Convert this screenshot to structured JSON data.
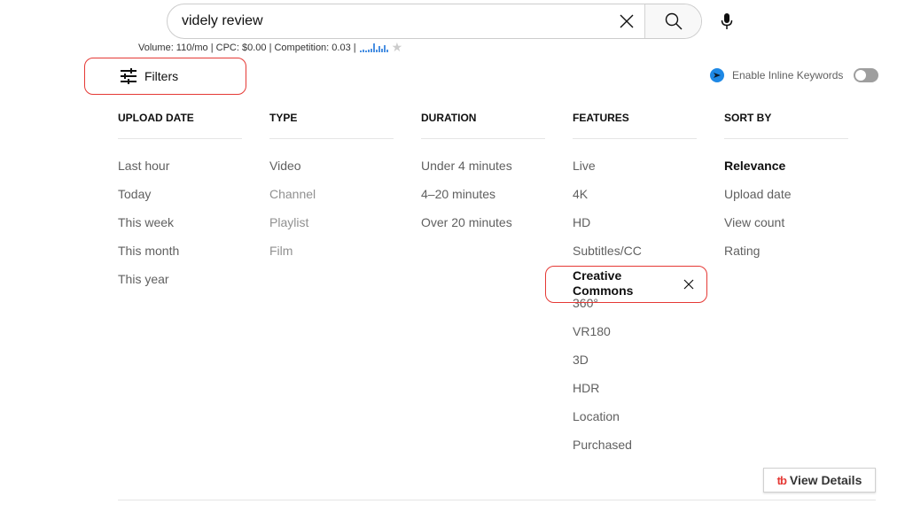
{
  "search": {
    "value": "videly review",
    "clear_icon": "close-icon",
    "search_icon": "search-icon",
    "mic_icon": "microphone-icon"
  },
  "keyword_stats": {
    "text": "Volume: 110/mo | CPC: $0.00 | Competition: 0.03 |",
    "trend_bars": [
      2,
      3,
      2,
      3,
      4,
      9,
      3,
      6,
      4,
      7,
      3
    ],
    "star_icon": "star-icon"
  },
  "filters_button": {
    "label": "Filters",
    "icon": "tune-icon"
  },
  "inline_keywords": {
    "label": "Enable Inline Keywords",
    "enabled": false
  },
  "columns": [
    {
      "header": "UPLOAD DATE",
      "options": [
        {
          "label": "Last hour"
        },
        {
          "label": "Today"
        },
        {
          "label": "This week"
        },
        {
          "label": "This month"
        },
        {
          "label": "This year"
        }
      ]
    },
    {
      "header": "TYPE",
      "options": [
        {
          "label": "Video"
        },
        {
          "label": "Channel"
        },
        {
          "label": "Playlist"
        },
        {
          "label": "Film"
        }
      ]
    },
    {
      "header": "DURATION",
      "options": [
        {
          "label": "Under 4 minutes"
        },
        {
          "label": "4–20 minutes"
        },
        {
          "label": "Over 20 minutes"
        }
      ]
    },
    {
      "header": "FEATURES",
      "options": [
        {
          "label": "Live"
        },
        {
          "label": "4K"
        },
        {
          "label": "HD"
        },
        {
          "label": "Subtitles/CC"
        },
        {
          "label": "Creative Commons",
          "line1": "Creative",
          "line2": "Commons"
        },
        {
          "label": "360°"
        },
        {
          "label": "VR180"
        },
        {
          "label": "3D"
        },
        {
          "label": "HDR"
        },
        {
          "label": "Location"
        },
        {
          "label": "Purchased"
        }
      ]
    },
    {
      "header": "SORT BY",
      "options": [
        {
          "label": "Relevance"
        },
        {
          "label": "Upload date"
        },
        {
          "label": "View count"
        },
        {
          "label": "Rating"
        }
      ]
    }
  ],
  "view_details": {
    "logo": "tb",
    "label": "View Details"
  }
}
